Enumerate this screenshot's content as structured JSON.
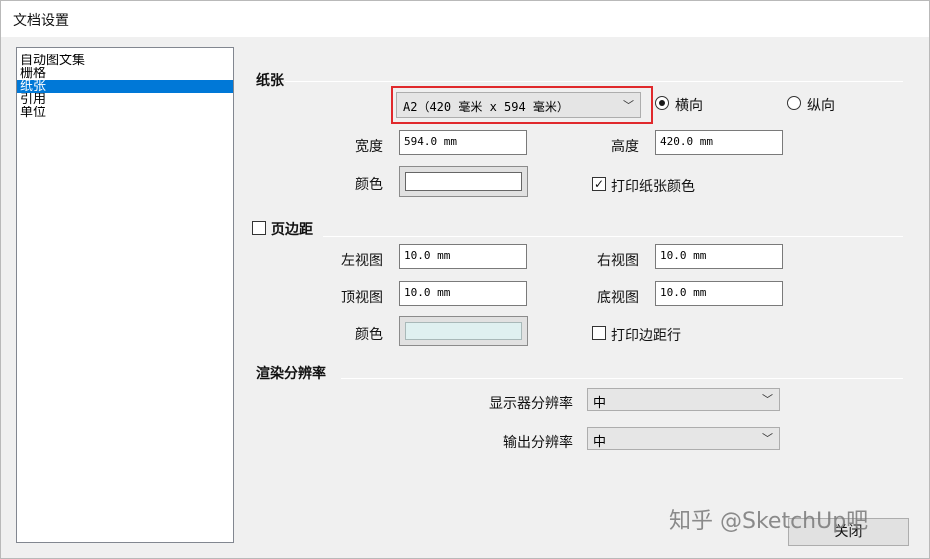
{
  "window": {
    "title": "文档设置"
  },
  "sidebar": {
    "items": [
      {
        "label": "自动图文集"
      },
      {
        "label": "栅格"
      },
      {
        "label": "纸张"
      },
      {
        "label": "引用"
      },
      {
        "label": "单位"
      }
    ],
    "selected_index": 2
  },
  "paper": {
    "section_title": "纸张",
    "size_value": "A2（420 毫米 x 594 毫米）",
    "orientation": {
      "landscape_label": "横向",
      "portrait_label": "纵向",
      "selected": "landscape"
    },
    "width_label": "宽度",
    "width_value": "594.0 mm",
    "height_label": "高度",
    "height_value": "420.0 mm",
    "color_label": "颜色",
    "color": "#ffffff",
    "print_color_label": "打印纸张颜色",
    "print_color_checked": true
  },
  "margins": {
    "section_label": "页边距",
    "enabled": false,
    "left_label": "左视图",
    "left_value": "10.0 mm",
    "right_label": "右视图",
    "right_value": "10.0 mm",
    "top_label": "顶视图",
    "top_value": "10.0 mm",
    "bottom_label": "底视图",
    "bottom_value": "10.0 mm",
    "color_label": "颜色",
    "color": "#dff0f0",
    "print_margins_label": "打印边距行",
    "print_margins_checked": false
  },
  "resolution": {
    "section_title": "渲染分辨率",
    "display_label": "显示器分辨率",
    "display_value": "中",
    "output_label": "输出分辨率",
    "output_value": "中"
  },
  "footer": {
    "close_label": "关闭"
  },
  "watermark": {
    "text": "知乎 @SketchUp吧"
  },
  "colors": {
    "selection": "#0078d7",
    "highlight_box": "#e0292c"
  }
}
